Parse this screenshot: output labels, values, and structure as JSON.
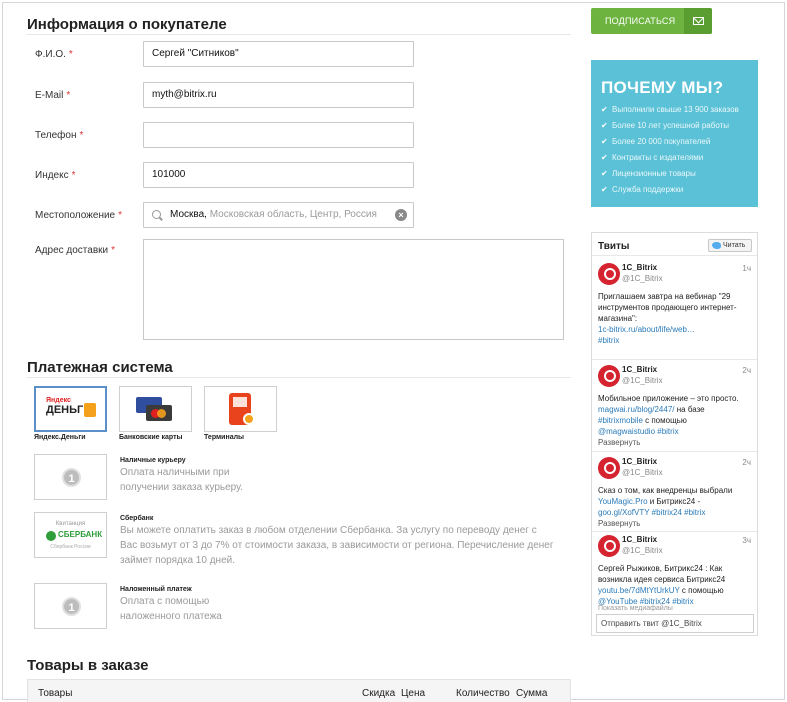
{
  "buyer": {
    "title": "Информация о покупателе",
    "fields": [
      {
        "label": "Ф.И.О.",
        "value": "Сергей \"Ситников\""
      },
      {
        "label": "E-Mail",
        "value": "myth@bitrix.ru"
      },
      {
        "label": "Телефон",
        "value": ""
      },
      {
        "label": "Индекс",
        "value": "101000"
      },
      {
        "label": "Местоположение",
        "city": "Москва,",
        "region": "Московская область, Центр, Россия"
      },
      {
        "label": "Адрес доставки",
        "value": ""
      }
    ],
    "required_mark": "*"
  },
  "payment": {
    "title": "Платежная система",
    "tiles": [
      {
        "caption": "Яндекс.Деньги",
        "logo_top": "Яндекс",
        "logo_main": "ДЕНЬГИ",
        "selected": true
      },
      {
        "caption": "Банковские карты",
        "selected": false
      },
      {
        "caption": "Терминалы",
        "selected": false
      }
    ],
    "rows": [
      {
        "name": "Наличные курьеру",
        "desc_lines": [
          "Оплата наличными при",
          "получении заказа курьеру."
        ],
        "icon": "coin-icon",
        "coin": "1"
      },
      {
        "name": "Сбербанк",
        "desc_lines": [
          "Вы можете оплатить заказ в любом отделении Сбербанка. За услугу по переводу денег с",
          "Вас возьмут от 3 до 7% от стоимости заказа, в зависимости от региона. Перечисление денег",
          "займет порядка 10 дней."
        ],
        "kvit": "Квитанция",
        "logo_text": "СБЕРБАНК",
        "logo_sub": "Сбербанк России"
      },
      {
        "name": "Наложенный платеж",
        "desc_lines": [
          "Оплата с помощью",
          "наложенного платежа"
        ],
        "icon": "coin-icon",
        "coin": "1"
      }
    ]
  },
  "goods": {
    "title": "Товары в заказе",
    "columns": [
      "Товары",
      "Скидка",
      "Цена",
      "Количество",
      "Сумма"
    ]
  },
  "subscribe": {
    "label": "ПОДПИСАТЬСЯ"
  },
  "why": {
    "title": "ПОЧЕМУ МЫ?",
    "items": [
      "Выполнили свыше 13 900 заказов",
      "Более 10 лет успешной работы",
      "Более 20 000 покупателей",
      "Контракты с издателями",
      "Лицензионные товары",
      "Служба поддержки"
    ]
  },
  "tweets": {
    "title": "Твиты",
    "follow": "Читать",
    "items": [
      {
        "name": "1C_Bitrix",
        "handle": "@1C_Bitrix",
        "time": "1ч",
        "text": [
          "Приглашаем завтра на вебинар \"29",
          "инструментов продающего интернет-",
          "магазина\":"
        ],
        "links": [
          "1c-bitrix.ru/about/life/web…",
          "#bitrix"
        ],
        "more": ""
      },
      {
        "name": "1C_Bitrix",
        "handle": "@1C_Bitrix",
        "time": "2ч",
        "text": [
          "Мобильное приложение – это просто."
        ],
        "links": [
          "magwai.ru/blog/2447/",
          "#bitrixmobile",
          "@magwaistudio #bitrix"
        ],
        "link_suffix": "  на базе",
        "mid_prefix": "",
        "mid_suffix": " с помощью",
        "more": "Развернуть"
      },
      {
        "name": "1C_Bitrix",
        "handle": "@1C_Bitrix",
        "time": "2ч",
        "text": [
          "Сказ о том, как внедренцы выбрали"
        ],
        "links": [
          "YouMagic.Pro",
          "goo.gl/XofVTY #bitrix24 #bitrix"
        ],
        "mid_suffix": " и Битрикс24 -",
        "more": "Развернуть"
      },
      {
        "name": "1C_Bitrix",
        "handle": "@1C_Bitrix",
        "time": "3ч",
        "text": [
          "Сергей Рыжиков, Битрикс24 : Как",
          "возникла идея сервиса Битрикс24"
        ],
        "links": [
          "youtu.be/7dMtYtUrkUY",
          "@YouTube #bitrix24 #bitrix"
        ],
        "link_suffix": " с помощью",
        "more": "Показать медиафайлы"
      }
    ],
    "send_placeholder": "Отправить твит @1C_Bitrix"
  }
}
